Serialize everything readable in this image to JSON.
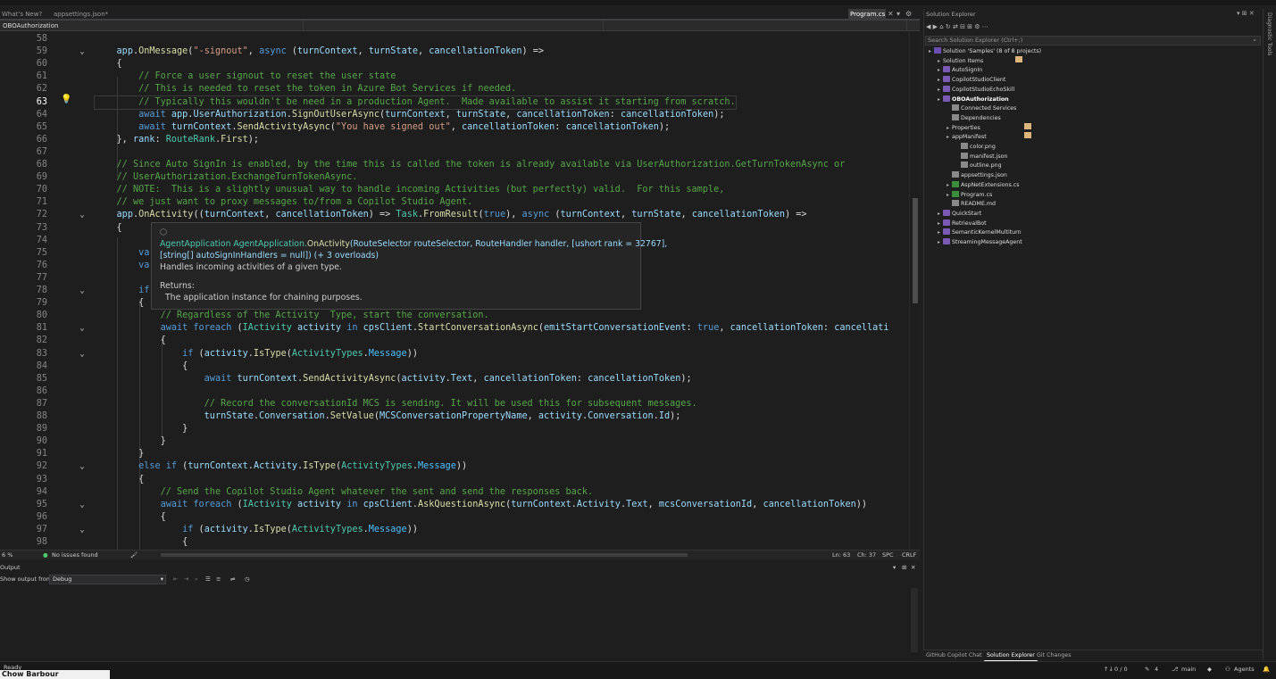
{
  "tabs": [
    {
      "label": "What's New?"
    },
    {
      "label": "appsettings.json*"
    },
    {
      "label": "Program.cs",
      "active": true
    }
  ],
  "navbar": {
    "project": "OBOAuthorization"
  },
  "editor": {
    "current_line": 63,
    "lines": [
      {
        "n": "58",
        "html": ""
      },
      {
        "n": "59",
        "html": "    <span class='pm'>app</span>.<span class='mt'>OnMessage</span>(<span class='str'>\"-signout\"</span>, <span class='kw'>async</span> (<span class='pm'>turnContext</span>, <span class='pm'>turnState</span>, <span class='pm'>cancellationToken</span>) =&gt;"
      },
      {
        "n": "60",
        "html": "    {"
      },
      {
        "n": "61",
        "html": "        <span class='cm'>// Force a user signout to reset the user state</span>"
      },
      {
        "n": "62",
        "html": "        <span class='cm'>// This is needed to reset the token in Azure Bot Services if needed.</span>"
      },
      {
        "n": "63",
        "html": "        <span class='cm'>// Typically this wouldn't be need in a production Agent.  Made available to assist it starting from scratch.</span>"
      },
      {
        "n": "64",
        "html": "        <span class='kw'>await</span> <span class='pm'>app</span>.<span class='pm'>UserAuthorization</span>.<span class='mt'>SignOutUserAsync</span>(<span class='pm'>turnContext</span>, <span class='pm'>turnState</span>, <span class='pm'>cancellationToken</span>: <span class='pm'>cancellationToken</span>);"
      },
      {
        "n": "65",
        "html": "        <span class='kw'>await</span> <span class='pm'>turnContext</span>.<span class='mt'>SendActivityAsync</span>(<span class='str'>\"You have signed out\"</span>, <span class='pm'>cancellationToken</span>: <span class='pm'>cancellationToken</span>);"
      },
      {
        "n": "66",
        "html": "    }, <span class='pm'>rank</span>: <span class='tp'>RouteRank</span>.<span class='mt'>First</span>);"
      },
      {
        "n": "67",
        "html": ""
      },
      {
        "n": "68",
        "html": "    <span class='cm'>// Since Auto SignIn is enabled, by the time this is called the token is already available via UserAuthorization.GetTurnTokenAsync or</span>"
      },
      {
        "n": "69",
        "html": "    <span class='cm'>// UserAuthorization.ExchangeTurnTokenAsync.</span>"
      },
      {
        "n": "70",
        "html": "    <span class='cm'>// NOTE:  This is a slightly unusual way to handle incoming Activities (but perfectly) valid.  For this sample,</span>"
      },
      {
        "n": "71",
        "html": "    <span class='cm'>// we just want to proxy messages to/from a Copilot Studio Agent.</span>"
      },
      {
        "n": "72",
        "html": "    <span class='pm'>app</span>.<span class='mt'>OnActivity</span>((<span class='pm'>turnContext</span>, <span class='pm'>cancellationToken</span>) =&gt; <span class='tp'>Task</span>.<span class='mt'>FromResult</span>(<span class='kw'>true</span>), <span class='kw'>async</span> (<span class='pm'>turnContext</span>, <span class='pm'>turnState</span>, <span class='pm'>cancellationToken</span>) =&gt;"
      },
      {
        "n": "73",
        "html": "    {"
      },
      {
        "n": "74",
        "html": ""
      },
      {
        "n": "75",
        "html": "        <span class='kw'>va</span>                                                                                  <span class='pm'>me</span>);"
      },
      {
        "n": "76",
        "html": "        <span class='kw'>va</span>"
      },
      {
        "n": "77",
        "html": ""
      },
      {
        "n": "78",
        "html": "        <span class='kw'>if</span>"
      },
      {
        "n": "79",
        "html": "        {"
      },
      {
        "n": "80",
        "html": "            <span class='cm'>// Regardless of the Activity  Type, start the conversation.</span>"
      },
      {
        "n": "81",
        "html": "            <span class='kw'>await</span> <span class='kw'>foreach</span> (<span class='tp'>IActivity</span> <span class='pm'>activity</span> <span class='kw'>in</span> <span class='pm'>cpsClient</span>.<span class='mt'>StartConversationAsync</span>(<span class='pm'>emitStartConversationEvent</span>: <span class='kw'>true</span>, <span class='pm'>cancellationToken</span>: <span class='pm'>cancellati</span>"
      },
      {
        "n": "82",
        "html": "            {"
      },
      {
        "n": "83",
        "html": "                <span class='kw'>if</span> (<span class='pm'>activity</span>.<span class='mt'>IsType</span>(<span class='tp'>ActivityTypes</span>.<span class='ct'>Message</span>))"
      },
      {
        "n": "84",
        "html": "                {"
      },
      {
        "n": "85",
        "html": "                    <span class='kw'>await</span> <span class='pm'>turnContext</span>.<span class='mt'>SendActivityAsync</span>(<span class='pm'>activity</span>.<span class='pm'>Text</span>, <span class='pm'>cancellationToken</span>: <span class='pm'>cancellationToken</span>);"
      },
      {
        "n": "86",
        "html": ""
      },
      {
        "n": "87",
        "html": "                    <span class='cm'>// Record the conversationId MCS is sending. It will be used this for subsequent messages.</span>"
      },
      {
        "n": "88",
        "html": "                    <span class='pm'>turnState</span>.<span class='pm'>Conversation</span>.<span class='mt'>SetValue</span>(<span class='pm'>MCSConversationPropertyName</span>, <span class='pm'>activity</span>.<span class='pm'>Conversation</span>.<span class='pm'>Id</span>);"
      },
      {
        "n": "89",
        "html": "                }"
      },
      {
        "n": "90",
        "html": "            }"
      },
      {
        "n": "91",
        "html": "        }"
      },
      {
        "n": "92",
        "html": "        <span class='kw'>else</span> <span class='kw'>if</span> (<span class='pm'>turnContext</span>.<span class='pm'>Activity</span>.<span class='mt'>IsType</span>(<span class='tp'>ActivityTypes</span>.<span class='ct'>Message</span>))"
      },
      {
        "n": "93",
        "html": "        {"
      },
      {
        "n": "94",
        "html": "            <span class='cm'>// Send the Copilot Studio Agent whatever the sent and send the responses back.</span>"
      },
      {
        "n": "95",
        "html": "            <span class='kw'>await</span> <span class='kw'>foreach</span> (<span class='tp'>IActivity</span> <span class='pm'>activity</span> <span class='kw'>in</span> <span class='pm'>cpsClient</span>.<span class='mt'>AskQuestionAsync</span>(<span class='pm'>turnContext</span>.<span class='pm'>Activity</span>.<span class='pm'>Text</span>, <span class='pm'>mcsConversationId</span>, <span class='pm'>cancellationToken</span>))"
      },
      {
        "n": "96",
        "html": "            {"
      },
      {
        "n": "97",
        "html": "                <span class='kw'>if</span> (<span class='pm'>activity</span>.<span class='mt'>IsType</span>(<span class='tp'>ActivityTypes</span>.<span class='ct'>Message</span>))"
      },
      {
        "n": "98",
        "html": "                {"
      }
    ],
    "folds": [
      "59",
      "72",
      "78",
      "81",
      "83",
      "92",
      "95",
      "97"
    ]
  },
  "tooltip": {
    "sig_type": "AgentApplication",
    "sig_rest": " AgentApplication.",
    "sig_method": "OnActivity",
    "sig_params": "(RouteSelector routeSelector, RouteHandler handler, [ushort rank = 32767],",
    "sig_params2": "[string[] autoSignInHandlers = null]) (+ 3 overloads)",
    "summary": "Handles incoming activities of a given type.",
    "returns_label": "Returns:",
    "returns_text": "The application instance for chaining purposes."
  },
  "editor_status": {
    "zoom": "6 %",
    "issues": "No issues found",
    "position": "Ln: 63",
    "column": "Ch: 37",
    "whitespace": "SPC",
    "eol": "CRLF"
  },
  "output": {
    "title": "Output",
    "show_from_label": "Show output from:",
    "source": "Debug"
  },
  "solution_explorer": {
    "title": "Solution Explorer",
    "search_placeholder": "Search Solution Explorer (Ctrl+;)",
    "items": [
      {
        "label": "Solution 'Samples' (8 of 8 projects)",
        "icon": "sol",
        "indent": 0
      },
      {
        "label": "Solution Items",
        "icon": "fold",
        "indent": 1
      },
      {
        "label": "AutoSignIn",
        "icon": "proj",
        "indent": 1
      },
      {
        "label": "CopilotStudioClient",
        "icon": "proj",
        "indent": 1
      },
      {
        "label": "CopilotStudioEchoSkill",
        "icon": "proj",
        "indent": 1
      },
      {
        "label": "OBOAuthorization",
        "icon": "proj",
        "indent": 1,
        "bold": true
      },
      {
        "label": "Connected Services",
        "icon": "file",
        "indent": 2
      },
      {
        "label": "Dependencies",
        "icon": "file",
        "indent": 2
      },
      {
        "label": "Properties",
        "icon": "fold",
        "indent": 2
      },
      {
        "label": "appManifest",
        "icon": "fold",
        "indent": 2
      },
      {
        "label": "color.png",
        "icon": "file",
        "indent": 3
      },
      {
        "label": "manifest.json",
        "icon": "file",
        "indent": 3
      },
      {
        "label": "outline.png",
        "icon": "file",
        "indent": 3
      },
      {
        "label": "appsettings.json",
        "icon": "file",
        "indent": 2
      },
      {
        "label": "AspNetExtensions.cs",
        "icon": "cs",
        "indent": 2
      },
      {
        "label": "Program.cs",
        "icon": "cs",
        "indent": 2
      },
      {
        "label": "README.md",
        "icon": "file",
        "indent": 2
      },
      {
        "label": "QuickStart",
        "icon": "proj",
        "indent": 1
      },
      {
        "label": "RetrievalBot",
        "icon": "proj",
        "indent": 1
      },
      {
        "label": "SemanticKernelMultiturn",
        "icon": "proj",
        "indent": 1
      },
      {
        "label": "StreamingMessageAgent",
        "icon": "proj",
        "indent": 1
      }
    ],
    "bottom_tabs": [
      "GitHub Copilot Chat",
      "Solution Explorer",
      "Git Changes"
    ]
  },
  "diagnostic": {
    "label": "Diagnostic Tools"
  },
  "statusbar": {
    "ready": "Ready",
    "lines_changed": "0 / 0",
    "pencil": "4",
    "branch": "main",
    "agents": "Agents"
  },
  "taskbar": {
    "name": "Chow Barbour"
  }
}
